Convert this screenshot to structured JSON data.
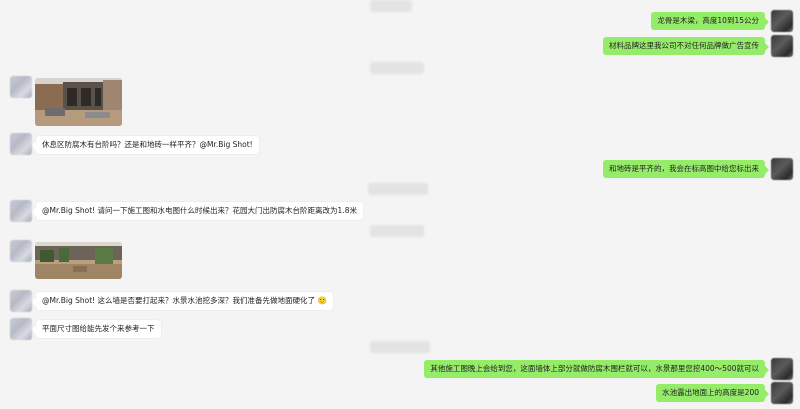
{
  "messages": {
    "m1": "龙骨是木梁，高度10到15公分",
    "m2": "材料品牌这里我公司不对任何品牌做广告宣传",
    "m3": "休息区防腐木有台阶吗？还是和地砖一样平齐？@Mr.Big Shot!",
    "m4": "和地砖是平齐的，我会在标高图中给您标出来",
    "m5": "@Mr.Big Shot! 请问一下施工图和水电图什么时候出来？花园大门出防腐木台阶距离改为1.8米",
    "m6": "@Mr.Big Shot! 这么墙是否要打起来？水景水池挖多深？我们准备先做地面硬化了",
    "m7": "平面尺寸图给能先发个来参考一下",
    "m8": "其他施工图晚上会给到您，这面墙体上部分就做防腐木围栏就可以，水景那里您挖400～500就可以",
    "m9": "水池露出地面上的高度是200"
  },
  "emoji": "🙂",
  "colors": {
    "background": "#f4f4f4",
    "incoming_bubble": "#ffffff",
    "outgoing_bubble": "#95ec69"
  }
}
